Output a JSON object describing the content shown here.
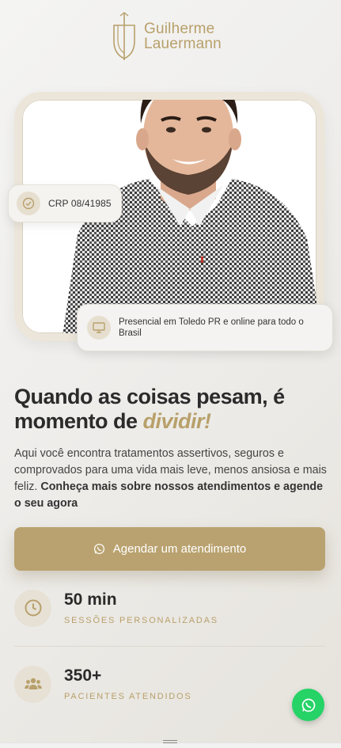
{
  "brand": {
    "line1": "Guilherme",
    "line2": "Lauermann"
  },
  "badges": {
    "crp": "CRP 08/41985",
    "location": "Presencial em Toledo PR e online para todo o Brasil"
  },
  "hero": {
    "headline_part1": "Quando as coisas ",
    "headline_bold1": "pesam",
    "headline_part2": ", é ",
    "headline_bold2": "momento de ",
    "headline_italic": "dividir!",
    "description": "Aqui você encontra tratamentos assertivos, seguros e comprovados para uma vida mais leve, menos ansiosa e mais feliz. ",
    "description_bold": "Conheça mais sobre nossos atendimentos e agende o seu agora"
  },
  "cta": {
    "label": "Agendar um atendimento"
  },
  "stats": [
    {
      "value": "50 min",
      "label": "SESSÕES PERSONALIZADAS",
      "icon": "clock-icon"
    },
    {
      "value": "350+",
      "label": "PACIENTES ATENDIDOS",
      "icon": "users-icon"
    }
  ],
  "colors": {
    "accent": "#b8a06b",
    "whatsapp": "#25d366"
  }
}
